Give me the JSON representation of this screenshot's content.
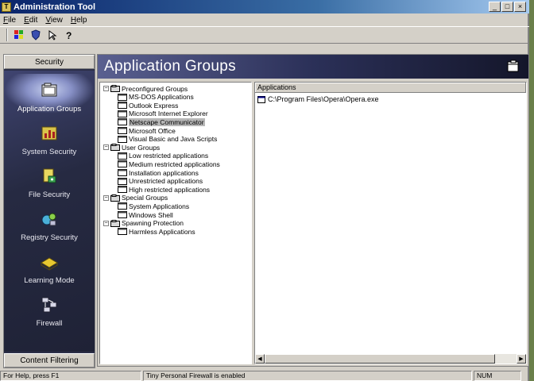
{
  "window": {
    "title": "Administration Tool",
    "controls": [
      "_",
      "□",
      "×"
    ]
  },
  "menu": [
    "File",
    "Edit",
    "View",
    "Help"
  ],
  "toolbar": {
    "icons": [
      "windows-icon",
      "shield-icon",
      "cursor-icon",
      "help-icon"
    ]
  },
  "sidebar": {
    "header": "Security",
    "footer": "Content Filtering",
    "items": [
      {
        "label": "Application Groups",
        "icon": "folder-icon",
        "active": true
      },
      {
        "label": "System Security",
        "icon": "chart-icon",
        "active": false
      },
      {
        "label": "File Security",
        "icon": "file-lock-icon",
        "active": false
      },
      {
        "label": "Registry Security",
        "icon": "registry-icon",
        "active": false
      },
      {
        "label": "Learning Mode",
        "icon": "book-icon",
        "active": false
      },
      {
        "label": "Firewall",
        "icon": "network-icon",
        "active": false
      }
    ]
  },
  "main": {
    "title": "Application Groups",
    "tree": [
      {
        "label": "Preconfigured Groups",
        "level": 0,
        "expander": "−"
      },
      {
        "label": "MS-DOS Applications",
        "level": 1
      },
      {
        "label": "Outlook Express",
        "level": 1
      },
      {
        "label": "Microsoft Internet Explorer",
        "level": 1
      },
      {
        "label": "Netscape Communicator",
        "level": 1,
        "selected": true
      },
      {
        "label": "Microsoft Office",
        "level": 1
      },
      {
        "label": "Visual Basic and Java Scripts",
        "level": 1
      },
      {
        "label": "User Groups",
        "level": 0,
        "expander": "−"
      },
      {
        "label": "Low restricted applications",
        "level": 1
      },
      {
        "label": "Medium restricted applications",
        "level": 1
      },
      {
        "label": "Installation applications",
        "level": 1
      },
      {
        "label": "Unrestricted applications",
        "level": 1
      },
      {
        "label": "High restricted applications",
        "level": 1
      },
      {
        "label": "Special Groups",
        "level": 0,
        "expander": "−"
      },
      {
        "label": "System Applications",
        "level": 1
      },
      {
        "label": "Windows Shell",
        "level": 1
      },
      {
        "label": "Spawning Protection",
        "level": 0,
        "expander": "−"
      },
      {
        "label": "Harmless Applications",
        "level": 1
      }
    ],
    "apps_header": "Applications",
    "apps": [
      "C:\\Program Files\\Opera\\Opera.exe"
    ]
  },
  "status": {
    "help": "For Help, press F1",
    "firewall": "Tiny Personal Firewall is enabled",
    "num": "NUM"
  }
}
